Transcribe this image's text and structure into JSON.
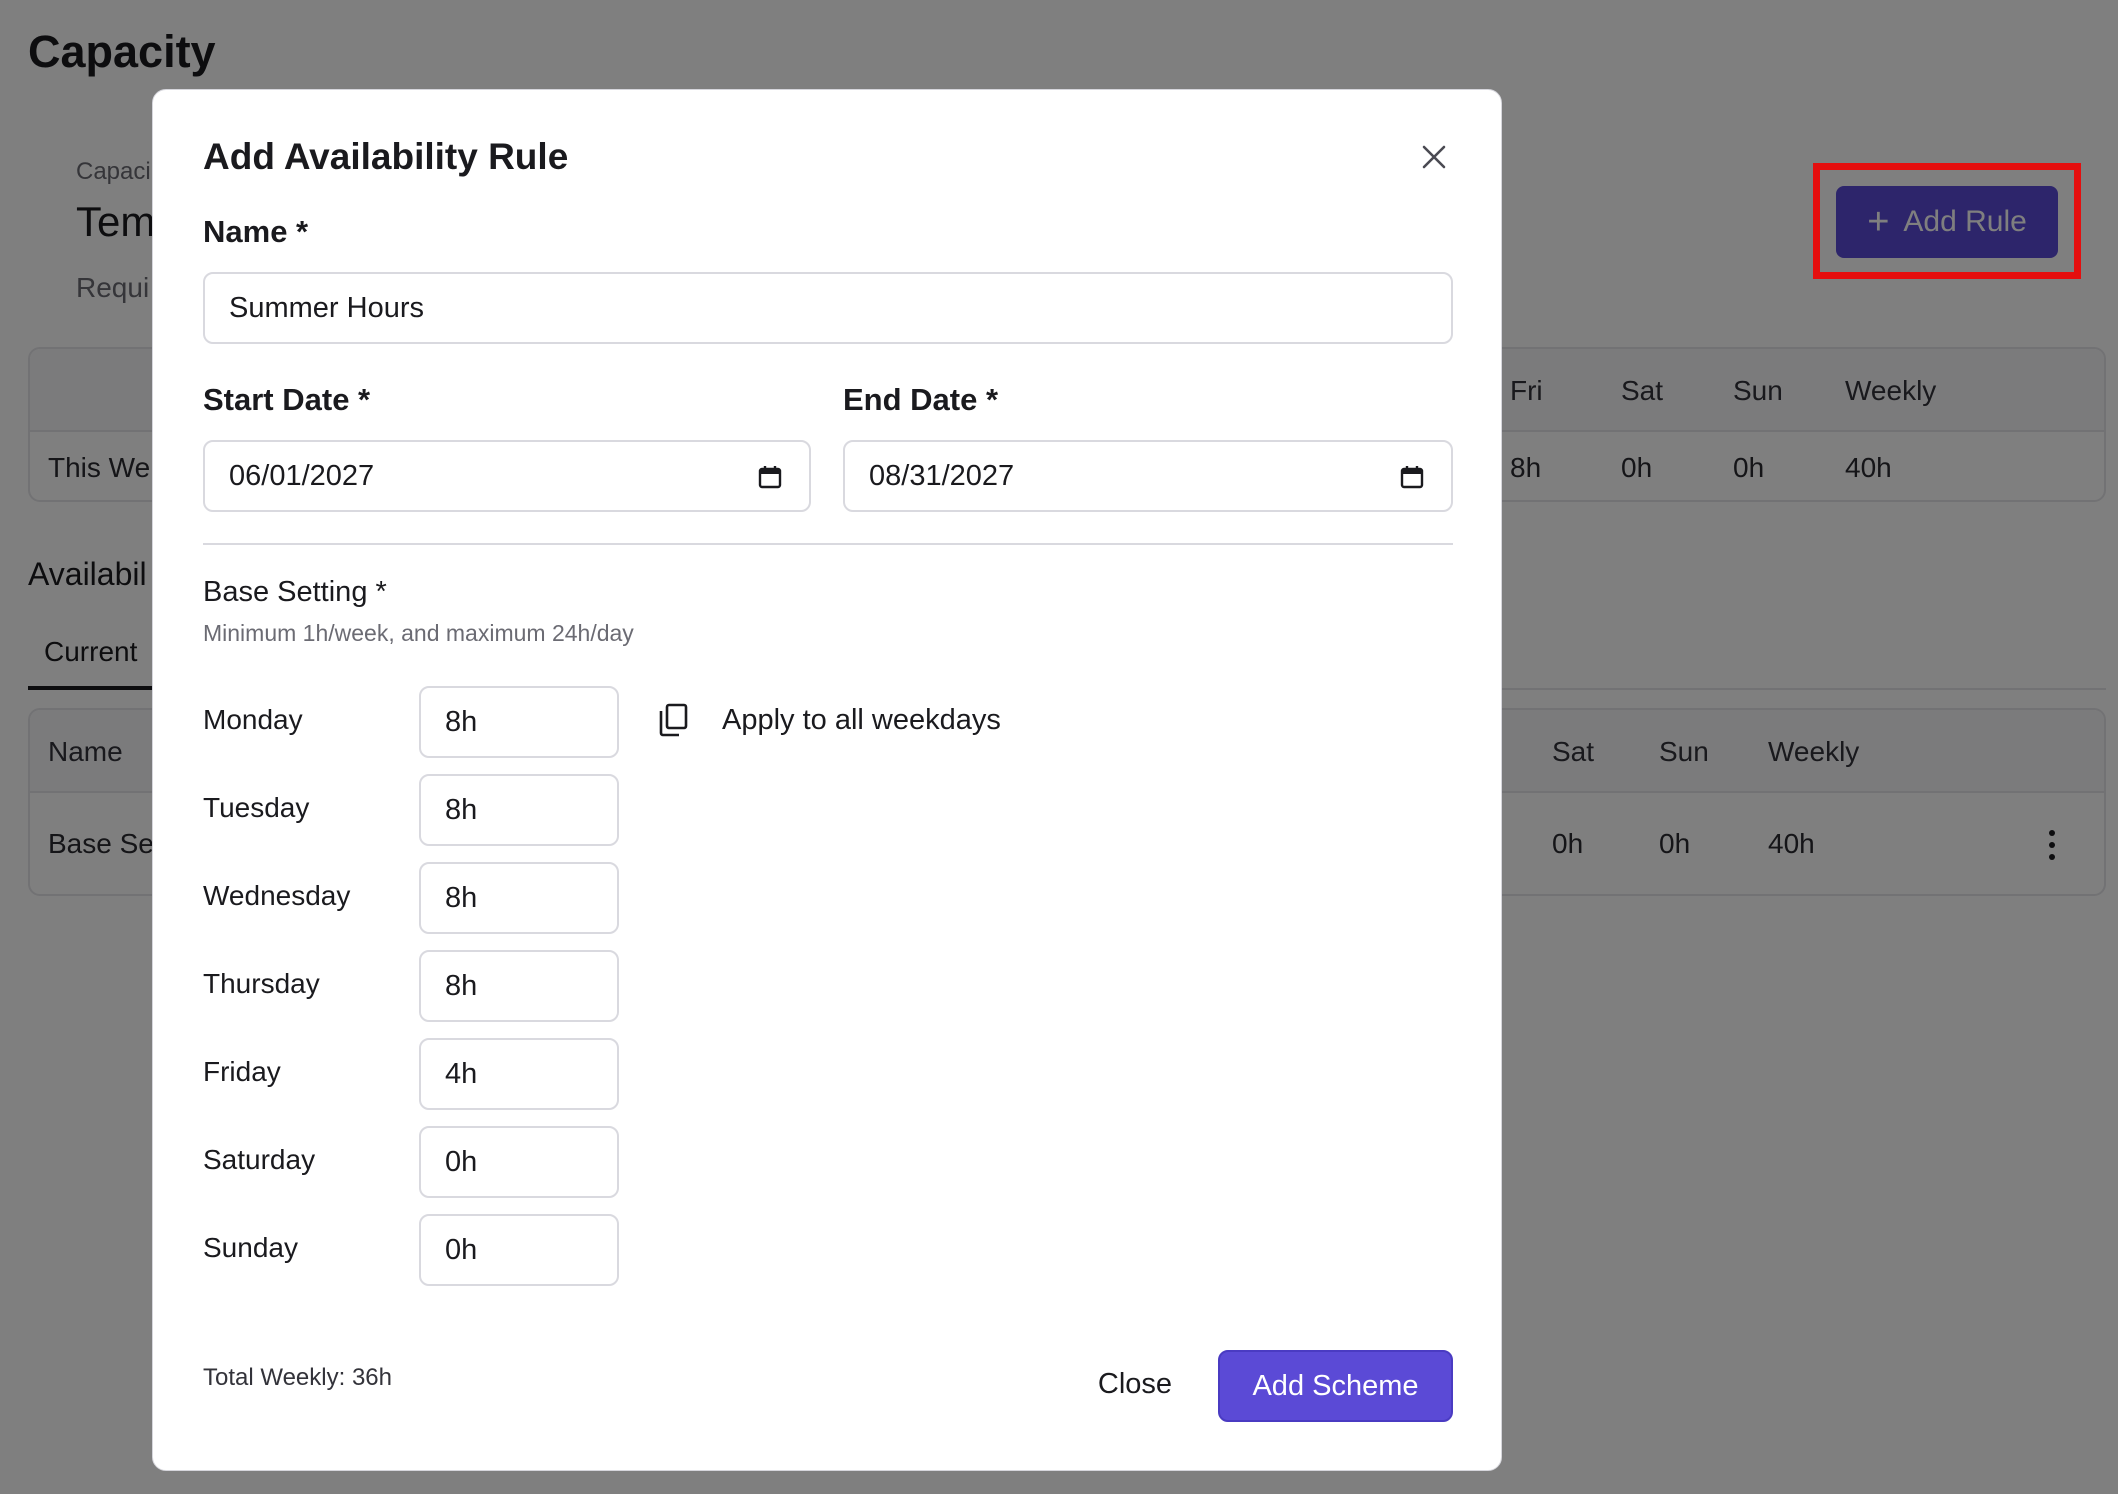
{
  "page": {
    "title": "Capacity",
    "capacity_label": "Capaci",
    "capacity_name": "Tem",
    "capacity_sub": "Requi",
    "add_rule_label": "Add Rule",
    "summary_table": {
      "headers": [
        "Fri",
        "Sat",
        "Sun",
        "Weekly"
      ],
      "row_label": "This We",
      "row_values": [
        "8h",
        "0h",
        "0h",
        "40h"
      ]
    },
    "availability_title": "Availabil",
    "tab_current": "Current",
    "rules_table": {
      "headers": [
        "Name",
        "Sat",
        "Sun",
        "Weekly"
      ],
      "row_name": "Base Se",
      "row_values": [
        "0h",
        "0h",
        "40h"
      ]
    }
  },
  "modal": {
    "title": "Add Availability Rule",
    "name_label": "Name *",
    "name_value": "Summer Hours",
    "start_label": "Start Date *",
    "start_value": "06/01/2027",
    "end_label": "End Date *",
    "end_value": "08/31/2027",
    "base_title": "Base Setting *",
    "base_hint": "Minimum 1h/week, and maximum 24h/day",
    "apply_label": "Apply to all weekdays",
    "days": [
      {
        "label": "Monday",
        "value": "8h"
      },
      {
        "label": "Tuesday",
        "value": "8h"
      },
      {
        "label": "Wednesday",
        "value": "8h"
      },
      {
        "label": "Thursday",
        "value": "8h"
      },
      {
        "label": "Friday",
        "value": "4h"
      },
      {
        "label": "Saturday",
        "value": "0h"
      },
      {
        "label": "Sunday",
        "value": "0h"
      }
    ],
    "total_weekly": "Total Weekly: 36h",
    "close_label": "Close",
    "submit_label": "Add Scheme"
  },
  "colors": {
    "accent": "#5b4ad6",
    "highlight": "#e50e0e",
    "overlay": "rgba(0,0,0,0.5)"
  }
}
